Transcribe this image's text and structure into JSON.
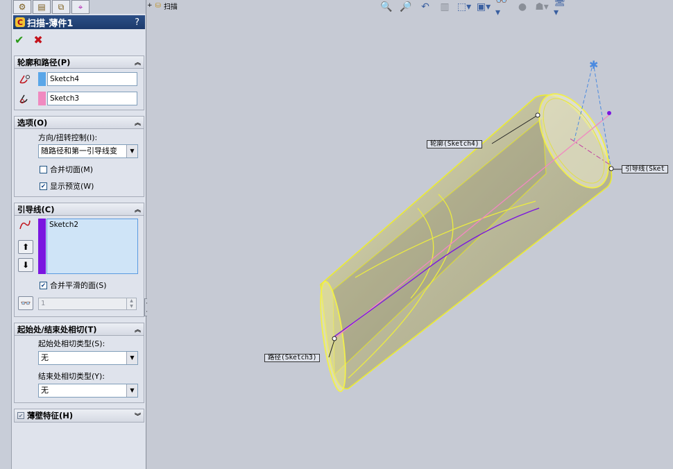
{
  "property_manager": {
    "title": "扫描-薄件1",
    "help": "?",
    "ok": "✔",
    "cancel": "✖",
    "profile_path": {
      "header": "轮廓和路径(P)",
      "profile": "Sketch4",
      "path": "Sketch3"
    },
    "options": {
      "header": "选项(O)",
      "orientation_label": "方向/扭转控制(I):",
      "orientation_value": "随路径和第一引导线变",
      "merge_tangent": "合并切面(M)",
      "show_preview": "显示预览(W)"
    },
    "guides": {
      "header": "引导线(C)",
      "item": "Sketch2",
      "merge_smooth": "合并平滑的面(S)",
      "spin_value": "1"
    },
    "tangency": {
      "header": "起始处/结束处相切(T)",
      "start_label": "起始处相切类型(S):",
      "start_value": "无",
      "end_label": "结束处相切类型(Y):",
      "end_value": "无"
    },
    "thin": {
      "header": "薄壁特征(H)"
    }
  },
  "viewport": {
    "tree_fragment": "扫描",
    "callout_profile": "轮廓(Sketch4)",
    "callout_guide": "引导线(Sket",
    "callout_path": "路径(Sketch3)"
  },
  "colors": {
    "profile": "#5aa6e8",
    "path": "#f08ac0",
    "guide": "#7a16e0",
    "preview": "#f2f04a"
  }
}
